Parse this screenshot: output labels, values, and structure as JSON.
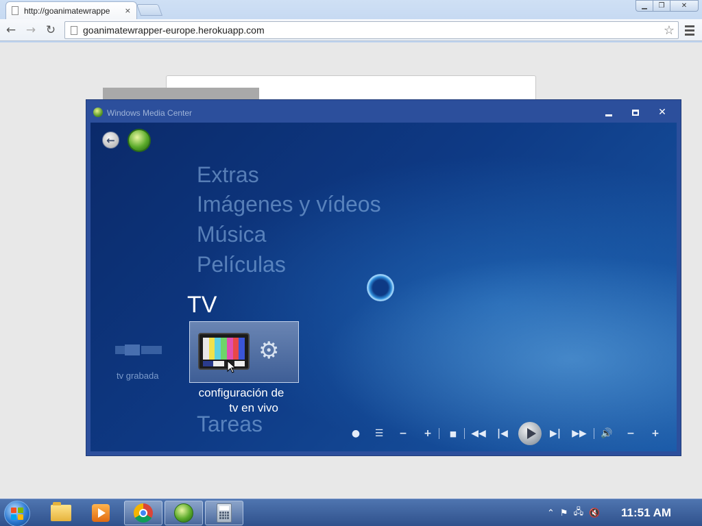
{
  "browser": {
    "tab_title": "http://goanimatewrappe",
    "tab_close": "×",
    "url": "goanimatewrapper-europe.herokuapp.com",
    "back_icon": "arrow-left-icon",
    "forward_icon": "arrow-right-icon",
    "reload_icon": "reload-icon",
    "star_icon": "star-icon",
    "menu_icon": "hamburger-icon"
  },
  "media_center": {
    "window_title": "Windows Media Center",
    "menu": {
      "extras": "Extras",
      "imagenes": "Imágenes y vídeos",
      "musica": "Música",
      "peliculas": "Películas",
      "tv": "TV",
      "tareas": "Tareas"
    },
    "tiles": {
      "grabada_label": "tv grabada",
      "config_label_line1": "configuración de",
      "config_label_line2": "tv en vivo"
    },
    "transport_icons": [
      "record-icon",
      "guide-icon",
      "channel-down-icon",
      "channel-up-icon",
      "stop-icon",
      "rewind-icon",
      "previous-icon",
      "play-icon",
      "next-icon",
      "fast-forward-icon",
      "volume-icon",
      "volume-down-icon",
      "volume-up-icon"
    ],
    "colors": {
      "accent": "#2c4f9c",
      "screen_bg": "#0e3a85",
      "menu_dim": "#96bee8"
    }
  },
  "taskbar": {
    "pinned": [
      "start-orb",
      "explorer-icon",
      "media-player-icon",
      "chrome-icon",
      "media-center-icon",
      "calculator-icon"
    ],
    "tray_icons": [
      "show-hidden-icon",
      "action-center-flag-icon",
      "network-icon",
      "volume-muted-icon"
    ],
    "clock": "11:51 AM"
  }
}
